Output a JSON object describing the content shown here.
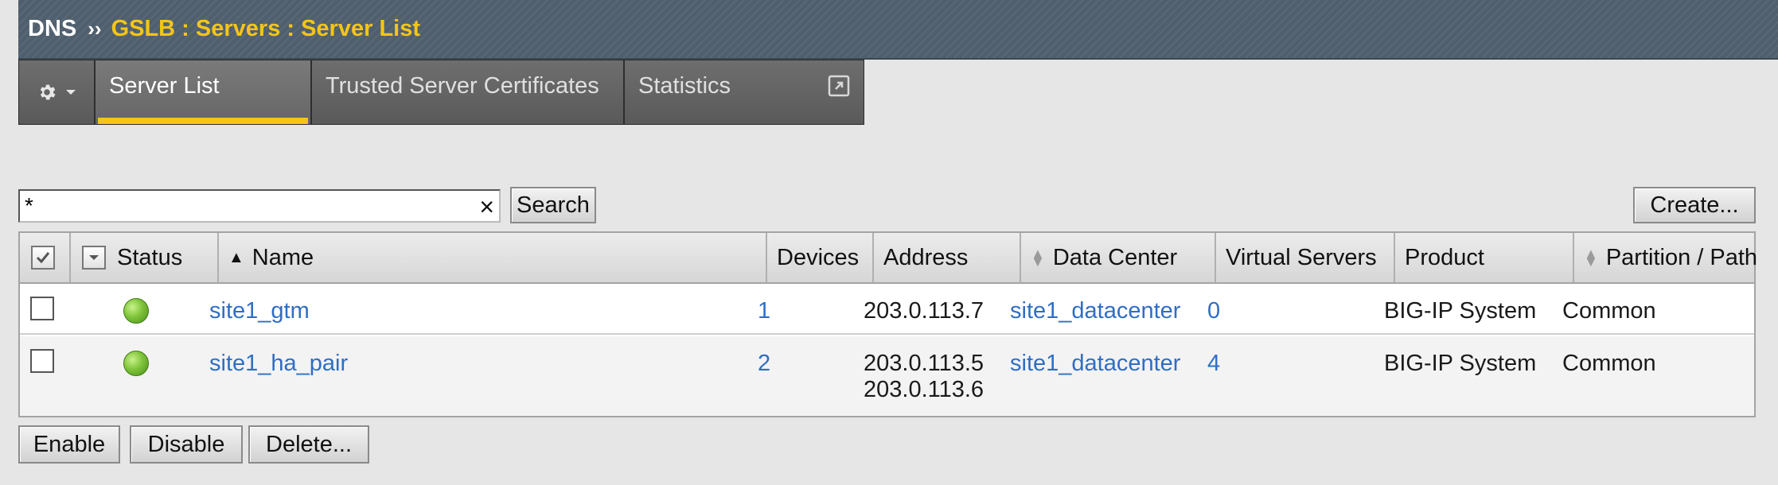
{
  "breadcrumb": {
    "root": "DNS",
    "separator": "››",
    "path": "GSLB : Servers : Server List"
  },
  "tabs": [
    {
      "label": "Server List",
      "active": true
    },
    {
      "label": "Trusted Server Certificates",
      "active": false
    },
    {
      "label": "Statistics",
      "active": false
    }
  ],
  "search": {
    "value": "*",
    "clear_glyph": "×",
    "button_label": "Search"
  },
  "create_label": "Create...",
  "table": {
    "headers": {
      "status": "Status",
      "name": "Name",
      "devices": "Devices",
      "address": "Address",
      "data_center": "Data Center",
      "virtual_servers": "Virtual Servers",
      "product": "Product",
      "partition": "Partition / Path"
    },
    "rows": [
      {
        "status": "available",
        "name": "site1_gtm",
        "devices": "1",
        "address": [
          "203.0.113.7"
        ],
        "data_center": "site1_datacenter",
        "virtual_servers": "0",
        "product": "BIG-IP System",
        "partition": "Common"
      },
      {
        "status": "available",
        "name": "site1_ha_pair",
        "devices": "2",
        "address": [
          "203.0.113.5",
          "203.0.113.6"
        ],
        "data_center": "site1_datacenter",
        "virtual_servers": "4",
        "product": "BIG-IP System",
        "partition": "Common"
      }
    ]
  },
  "actions": {
    "enable": "Enable",
    "disable": "Disable",
    "delete": "Delete..."
  },
  "colors": {
    "breadcrumb_path": "#f5c518",
    "active_tab_indicator": "#f5c518",
    "link": "#2f6ec4",
    "status_available": "#7fc43a"
  },
  "icons": {
    "tab_menu": "gear-icon",
    "statistics_popout": "external-link-icon",
    "status": "green-circle-icon"
  }
}
